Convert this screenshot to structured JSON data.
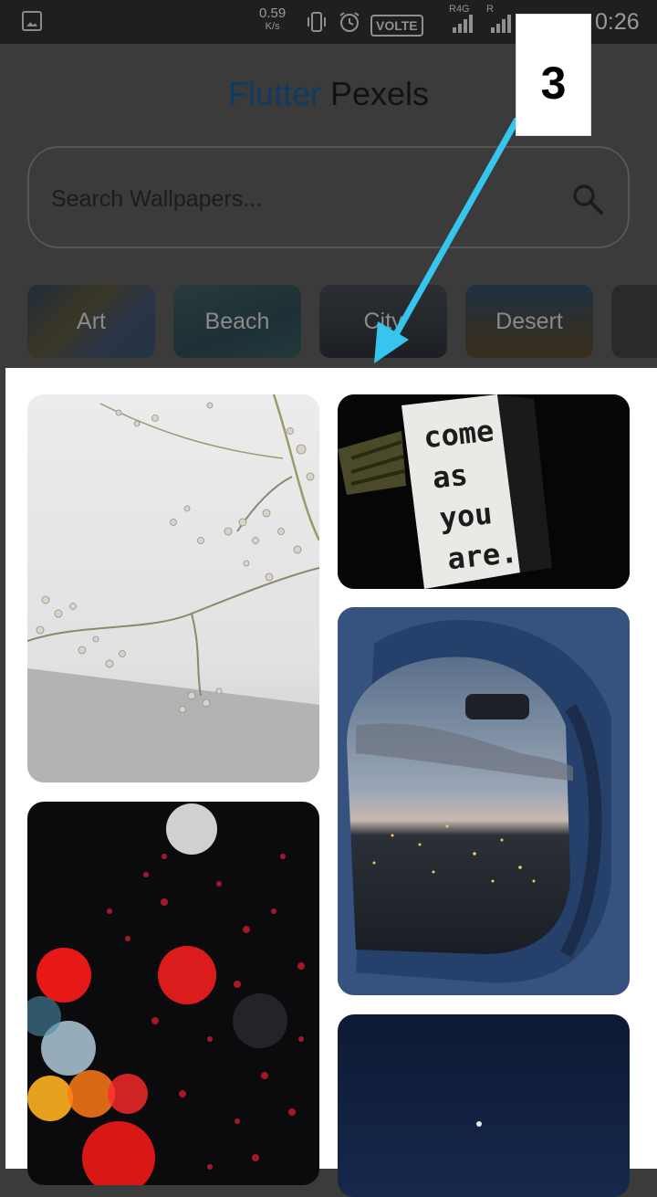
{
  "status_bar": {
    "speed_value": "0.59",
    "speed_unit": "K/s",
    "volte": "VOLTE",
    "sim1_label": "R4G",
    "sim2_label": "R",
    "time": "0:26"
  },
  "app": {
    "title_part1": "Flutter",
    "title_part2": "Pexels"
  },
  "search": {
    "placeholder": "Search Wallpapers..."
  },
  "categories": [
    {
      "label": "Art"
    },
    {
      "label": "Beach"
    },
    {
      "label": "City"
    },
    {
      "label": "Desert"
    }
  ],
  "wallpapers": [
    {
      "description_text": "come as you are."
    }
  ],
  "annotation": {
    "step_number": "3"
  },
  "colors": {
    "title_accent": "#0f3b63",
    "arrow": "#36c5ee"
  }
}
